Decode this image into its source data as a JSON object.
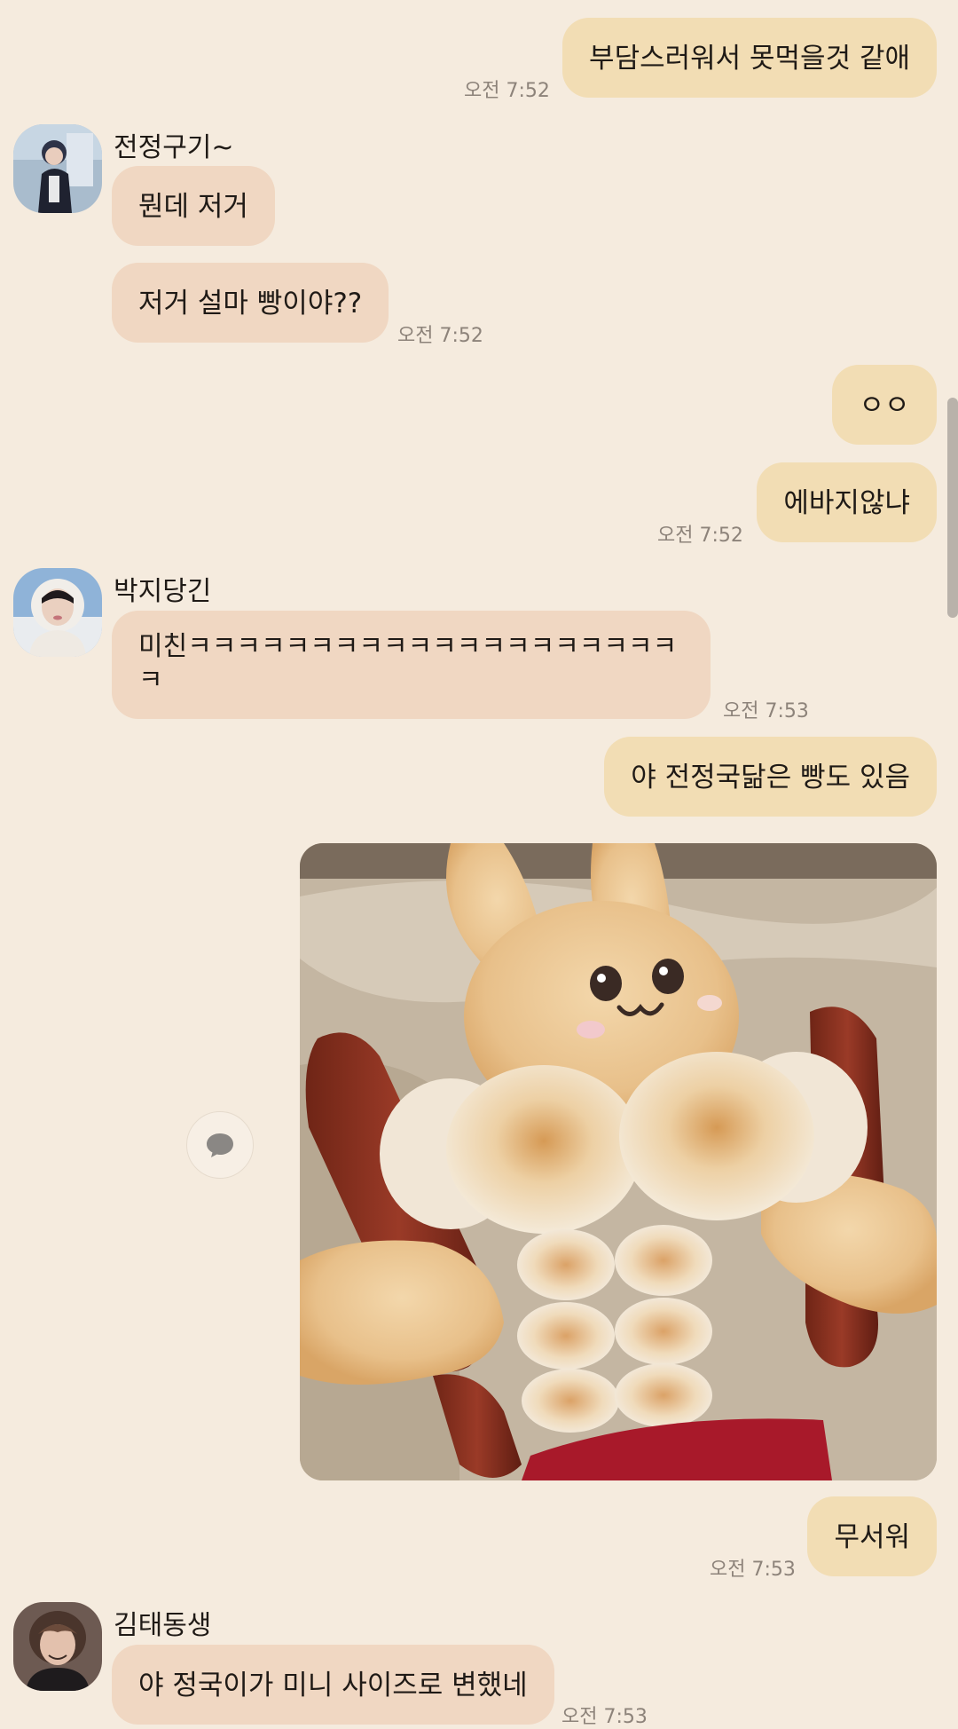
{
  "messages": {
    "m1": {
      "text": "부담스러워서 못먹을것 같애",
      "time": "오전 7:52"
    },
    "jk": {
      "name": "전정구기~",
      "msg1": "뭔데 저거",
      "msg2": "저거 설마 빵이야??",
      "time": "오전 7:52"
    },
    "m2": {
      "text": "ㅇㅇ"
    },
    "m3": {
      "text": "에바지않냐",
      "time": "오전 7:52"
    },
    "jm": {
      "name": "박지당긴",
      "line1": "미친ㅋㅋㅋㅋㅋㅋㅋㅋㅋㅋㅋㅋㅋㅋㅋㅋㅋㅋㅋㅋ",
      "line2": "ㅋ",
      "time": "오전 7:53"
    },
    "m4": {
      "text": "야 전정국닮은 빵도 있음"
    },
    "m5": {
      "text": "무서워",
      "time": "오전 7:53"
    },
    "th": {
      "name": "김태동생",
      "msg": "야 정국이가 미니 사이즈로 변했네",
      "time": "오전 7:53"
    }
  },
  "icons": {
    "comment": "speech-bubble-icon",
    "photo": "bunny-bread-photo"
  },
  "colors": {
    "background": "#f5ebde",
    "my_bubble": "#f2ddb4",
    "their_bubble": "#f0d7c2",
    "timestamp": "#8d837a"
  }
}
